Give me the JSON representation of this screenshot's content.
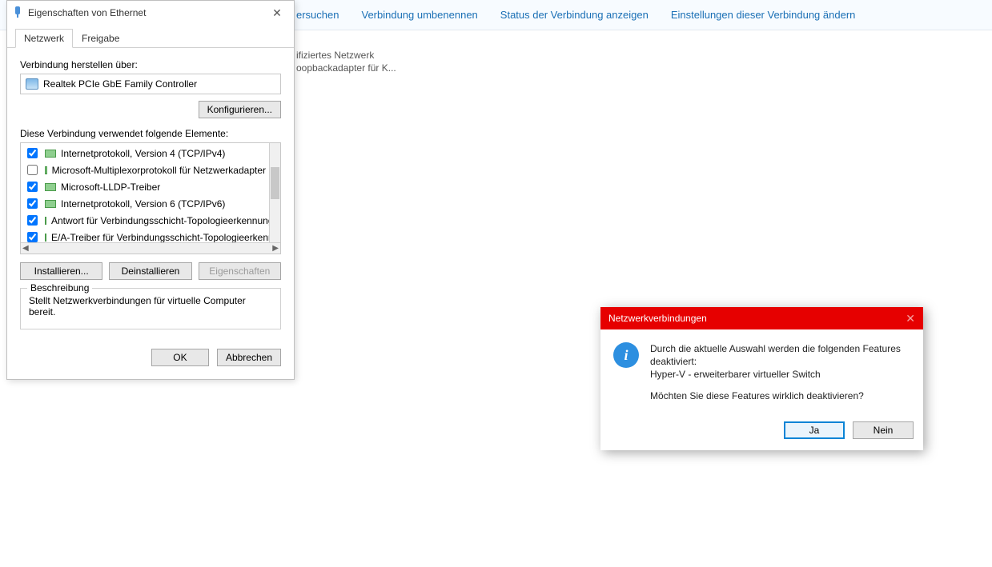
{
  "background": {
    "cmd1": "ersuchen",
    "cmd2": "Verbindung umbenennen",
    "cmd3": "Status der Verbindung anzeigen",
    "cmd4": "Einstellungen dieser Verbindung ändern",
    "line1": "ifiziertes Netzwerk",
    "line2": "oopbackadapter für K..."
  },
  "props": {
    "title": "Eigenschaften von Ethernet",
    "tab_network": "Netzwerk",
    "tab_sharing": "Freigabe",
    "connect_using_label": "Verbindung herstellen über:",
    "adapter_name": "Realtek PCIe GbE Family Controller",
    "configure_btn": "Konfigurieren...",
    "elements_label": "Diese Verbindung verwendet folgende Elemente:",
    "items": [
      {
        "checked": true,
        "label": "Internetprotokoll, Version 4 (TCP/IPv4)"
      },
      {
        "checked": false,
        "label": "Microsoft-Multiplexorprotokoll für Netzwerkadapter"
      },
      {
        "checked": true,
        "label": "Microsoft-LLDP-Treiber"
      },
      {
        "checked": true,
        "label": "Internetprotokoll, Version 6 (TCP/IPv6)"
      },
      {
        "checked": true,
        "label": "Antwort für Verbindungsschicht-Topologieerkennung"
      },
      {
        "checked": true,
        "label": "E/A-Treiber für Verbindungsschicht-Topologieerkennur"
      },
      {
        "checked": true,
        "label": "Hyper-V - erweiterbarer virtueller Switch"
      }
    ],
    "install_btn": "Installieren...",
    "uninstall_btn": "Deinstallieren",
    "properties_btn": "Eigenschaften",
    "desc_legend": "Beschreibung",
    "desc_text": "Stellt Netzwerkverbindungen für virtuelle Computer bereit.",
    "ok_btn": "OK",
    "cancel_btn": "Abbrechen"
  },
  "confirm": {
    "title": "Netzwerkverbindungen",
    "line1": "Durch die aktuelle Auswahl werden die folgenden Features deaktiviert:",
    "line2": "Hyper-V - erweiterbarer virtueller Switch",
    "line3": "Möchten Sie diese Features wirklich deaktivieren?",
    "yes": "Ja",
    "no": "Nein"
  }
}
